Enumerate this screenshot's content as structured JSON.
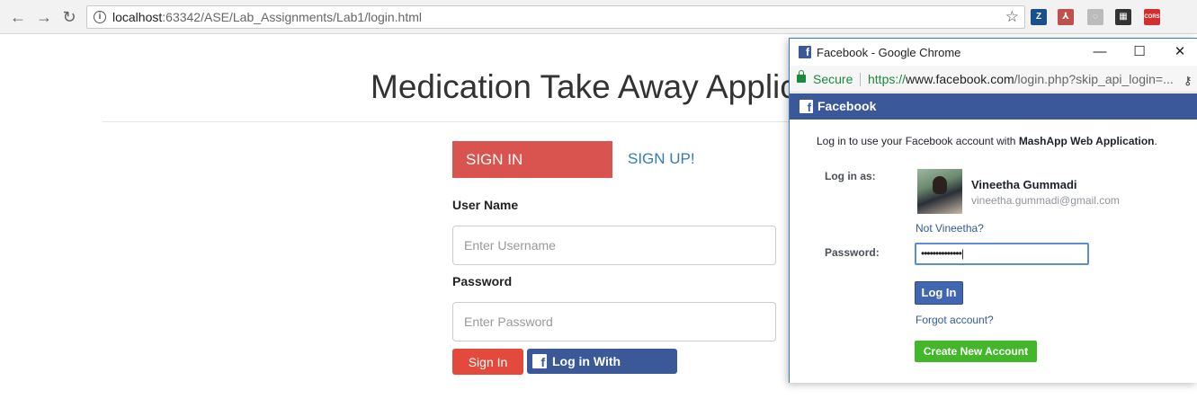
{
  "browser": {
    "url_host": "localhost",
    "url_rest": ":63342/ASE/Lab_Assignments/Lab1/login.html",
    "extensions": [
      {
        "name": "zotero-icon",
        "label": "Z",
        "color": "#1b4f8c"
      },
      {
        "name": "pdf-icon",
        "label": "⅄",
        "color": "#c0504d"
      },
      {
        "name": "circle-ext-icon",
        "label": "◌",
        "color": "#bbbbbb"
      },
      {
        "name": "clapper-icon",
        "label": "▦",
        "color": "#333333"
      },
      {
        "name": "cors-icon",
        "label": "CORS",
        "color": "#d32f2f"
      }
    ]
  },
  "page": {
    "title": "Medication Take Away Applic",
    "tabs": {
      "signin": "SIGN IN",
      "signup": "SIGN UP!"
    },
    "username_label": "User Name",
    "username_placeholder": "Enter Username",
    "password_label": "Password",
    "password_placeholder": "Enter Password",
    "signin_button": "Sign In",
    "facebook_button": "Log in With Facebook"
  },
  "popup": {
    "window_title": "Facebook - Google Chrome",
    "secure_label": "Secure",
    "url_scheme": "https://",
    "url_host": "www.facebook.com",
    "url_rest": "/login.php?skip_api_login=...",
    "header_title": "Facebook",
    "intro_prefix": "Log in to use your Facebook account with ",
    "intro_app": "MashApp Web Application",
    "intro_suffix": ".",
    "login_as_label": "Log in as:",
    "user_name": "Vineetha Gummadi",
    "user_email": "vineetha.gummadi@gmail.com",
    "not_user_link": "Not Vineetha?",
    "password_label": "Password:",
    "password_value": "••••••••••••••|",
    "login_button": "Log In",
    "forgot_link": "Forgot account?",
    "create_button": "Create New Account"
  },
  "colors": {
    "signin_tab": "#d9534f",
    "facebook_blue": "#3b5998",
    "create_green": "#42b72a",
    "secure_green": "#1a8a3c"
  }
}
